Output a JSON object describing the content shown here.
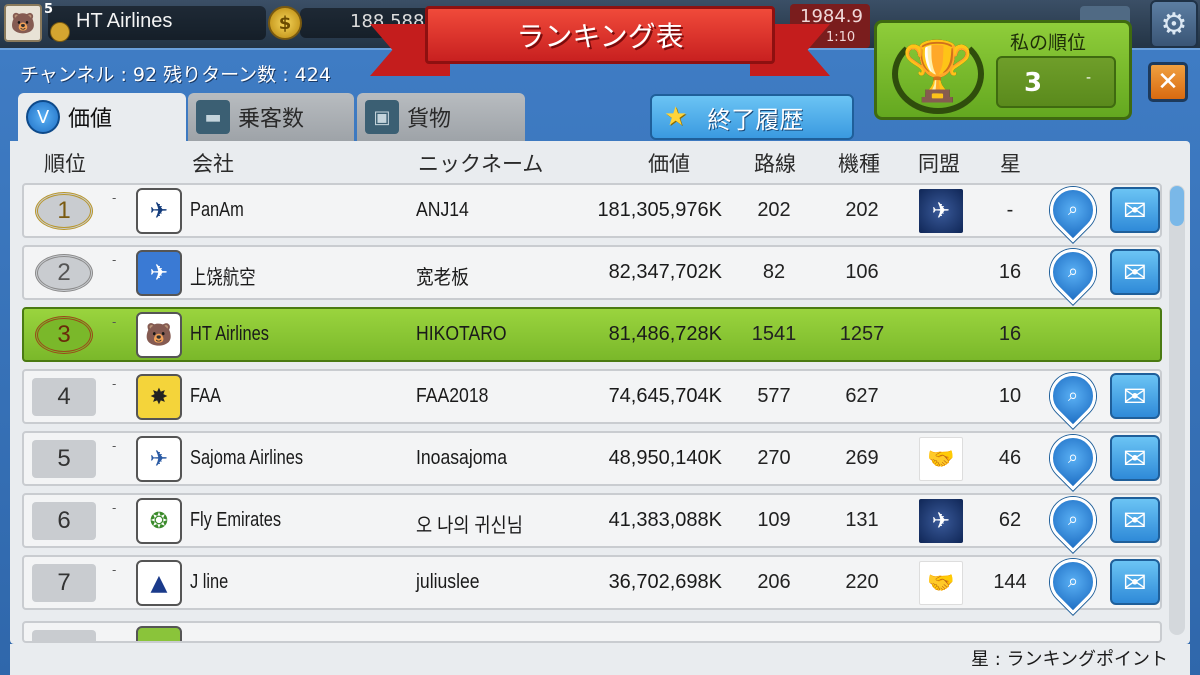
{
  "hud": {
    "level": "5",
    "airline_name": "HT Airlines",
    "money": "188,588",
    "year": "1984.9",
    "time": "1:10"
  },
  "ribbon_title": "ランキング表",
  "channel_info": "チャンネル : 92  残りターン数 : 424",
  "my_rank": {
    "label": "私の順位",
    "value": "3",
    "change": "-"
  },
  "tabs": [
    {
      "label": "価値",
      "icon": "v-value-icon",
      "active": true
    },
    {
      "label": "乗客数",
      "icon": "seat-icon",
      "active": false
    },
    {
      "label": "貨物",
      "icon": "cargo-box-icon",
      "active": false
    }
  ],
  "history_button": "終了履歴",
  "columns": {
    "rank": "順位",
    "company": "会社",
    "nickname": "ニックネーム",
    "value": "価値",
    "routes": "路線",
    "planes": "機種",
    "alliance": "同盟",
    "stars": "星"
  },
  "rows": [
    {
      "rank": "1",
      "change": "-",
      "company": "PanAm",
      "nickname": "ANJ14",
      "value": "181,305,976K",
      "routes": "202",
      "planes": "202",
      "alliance": "navy",
      "stars": "-"
    },
    {
      "rank": "2",
      "change": "-",
      "company": "上饶航空",
      "nickname": "宽老板",
      "value": "82,347,702K",
      "routes": "82",
      "planes": "106",
      "alliance": "",
      "stars": "16"
    },
    {
      "rank": "3",
      "change": "-",
      "company": "HT Airlines",
      "nickname": "HIKOTARO",
      "value": "81,486,728K",
      "routes": "1541",
      "planes": "1257",
      "alliance": "",
      "stars": "16"
    },
    {
      "rank": "4",
      "change": "-",
      "company": "FAA",
      "nickname": "FAA2018",
      "value": "74,645,704K",
      "routes": "577",
      "planes": "627",
      "alliance": "",
      "stars": "10"
    },
    {
      "rank": "5",
      "change": "-",
      "company": "Sajoma Airlines",
      "nickname": "Inoasajoma",
      "value": "48,950,140K",
      "routes": "270",
      "planes": "269",
      "alliance": "orange",
      "stars": "46"
    },
    {
      "rank": "6",
      "change": "-",
      "company": "Fly Emirates",
      "nickname": "오 나의 귀신님",
      "value": "41,383,088K",
      "routes": "109",
      "planes": "131",
      "alliance": "navy",
      "stars": "62"
    },
    {
      "rank": "7",
      "change": "-",
      "company": "J line",
      "nickname": "juliuslee",
      "value": "36,702,698K",
      "routes": "206",
      "planes": "220",
      "alliance": "orange",
      "stars": "144"
    }
  ],
  "footer_note": "星 : ランキングポイント",
  "colors": {
    "panel_blue": "#3f7cc4",
    "highlight_green": "#8fcd3a",
    "ribbon_red": "#c82020"
  }
}
